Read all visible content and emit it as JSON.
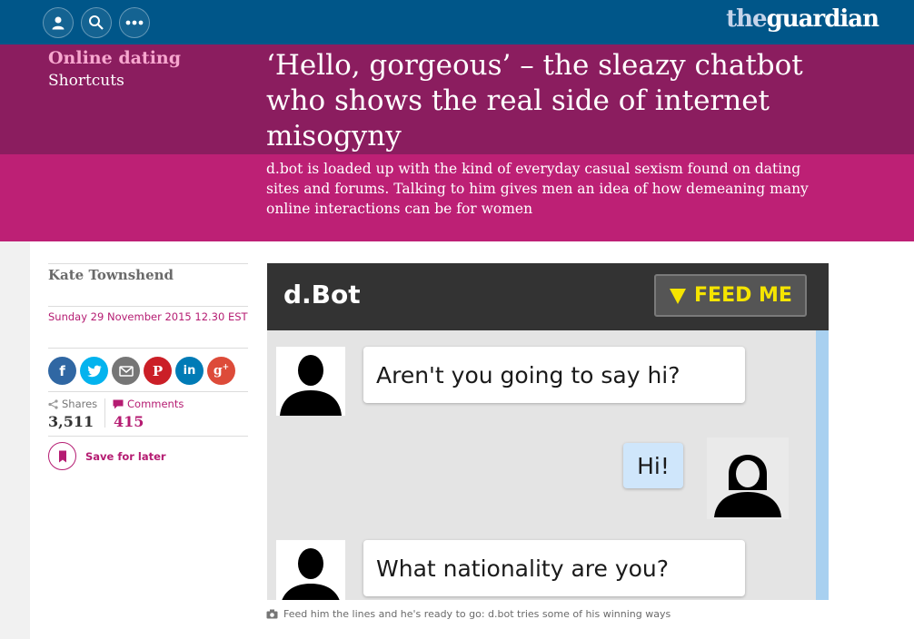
{
  "nav": {
    "profile_icon": "person-icon",
    "search_icon": "search-icon",
    "more_icon": "more-icon",
    "logo_prefix": "the",
    "logo_name": "guardian",
    "bar_color": "#005689"
  },
  "header": {
    "section": "Online dating",
    "subsection": "Shortcuts",
    "headline": "‘Hello, gorgeous’ – the sleazy chatbot who shows the real side of internet misogyny",
    "standfirst": "d.bot is loaded up with the kind of everyday casual sexism found on dating sites and forums. Talking to him gives men an idea of how demeaning many online interactions can be for women",
    "accent_color": "#b51c72"
  },
  "meta": {
    "author": "Kate Townshend",
    "date": "Sunday 29 November 2015 12.30 EST",
    "share_buttons": [
      {
        "label": "f",
        "icon": "facebook-icon",
        "color": "#3067a3"
      },
      {
        "label": "t",
        "icon": "twitter-icon",
        "color": "#03b3ee"
      },
      {
        "label": "email",
        "icon": "email-icon",
        "color": "#767676"
      },
      {
        "label": "P",
        "icon": "pinterest-icon",
        "color": "#cb1f27"
      },
      {
        "label": "in",
        "icon": "linkedin-icon",
        "color": "#007bb6"
      },
      {
        "label": "g+",
        "icon": "google-plus-icon",
        "color": "#dd4b39"
      }
    ],
    "shares_label": "Shares",
    "shares_count": "3,511",
    "comments_label": "Comments",
    "comments_count": "415",
    "save_label": "Save for later"
  },
  "image": {
    "brand": "d.Bot",
    "feed_button": "FEED ME",
    "messages": [
      {
        "from": "bot",
        "text": "Aren't you going to say hi?"
      },
      {
        "from": "user",
        "text": "Hi!"
      },
      {
        "from": "bot",
        "text": "What nationality are you?"
      }
    ],
    "caption": "Feed him the lines and he's ready to go: d.bot tries some of his winning ways"
  }
}
